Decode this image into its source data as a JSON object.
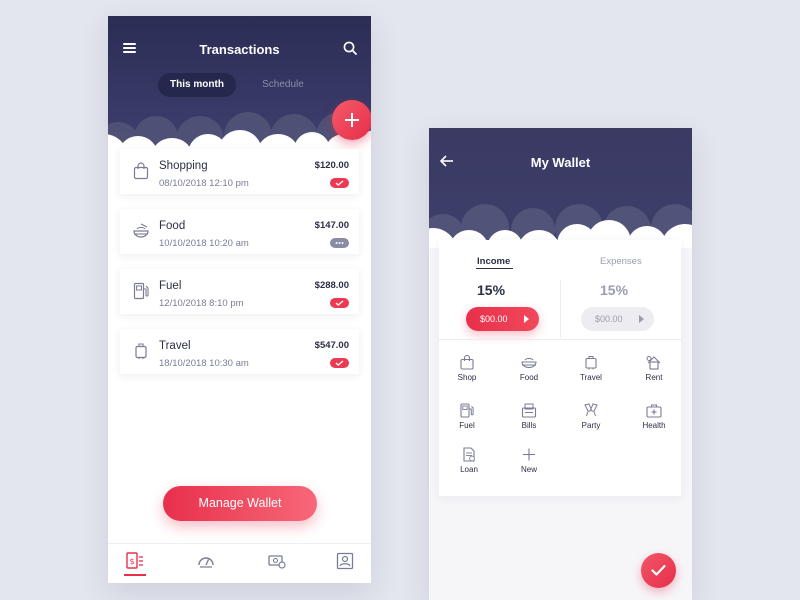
{
  "transactions_screen": {
    "title": "Transactions",
    "tabs": [
      {
        "label": "This month",
        "active": true
      },
      {
        "label": "Schedule",
        "active": false
      }
    ],
    "items": [
      {
        "name": "Shopping",
        "date": "08/10/2018  12:10 pm",
        "amount": "$120.00",
        "status": "done",
        "icon": "shopping-bag-icon"
      },
      {
        "name": "Food",
        "date": "10/10/2018  10:20 am",
        "amount": "$147.00",
        "status": "pending",
        "icon": "food-bowl-icon"
      },
      {
        "name": "Fuel",
        "date": "12/10/2018  8:10 pm",
        "amount": "$288.00",
        "status": "done",
        "icon": "fuel-pump-icon"
      },
      {
        "name": "Travel",
        "date": "18/10/2018  10:30 am",
        "amount": "$547.00",
        "status": "done",
        "icon": "luggage-icon"
      }
    ],
    "manage_button": "Manage Wallet",
    "nav": [
      {
        "icon": "wallet-list-icon",
        "active": true
      },
      {
        "icon": "speedometer-icon",
        "active": false
      },
      {
        "icon": "money-icon",
        "active": false
      },
      {
        "icon": "profile-card-icon",
        "active": false
      }
    ]
  },
  "wallet_screen": {
    "title": "My Wallet",
    "tabs": {
      "income": "Income",
      "expenses": "Expenses"
    },
    "income": {
      "percent": "15%",
      "amount": "$00.00"
    },
    "expenses": {
      "percent": "15%",
      "amount": "$00.00"
    },
    "categories": [
      {
        "label": "Shop",
        "icon": "shopping-bag-icon"
      },
      {
        "label": "Food",
        "icon": "food-bowl-icon"
      },
      {
        "label": "Travel",
        "icon": "luggage-icon"
      },
      {
        "label": "Rent",
        "icon": "rent-house-icon"
      },
      {
        "label": "Fuel",
        "icon": "fuel-pump-icon"
      },
      {
        "label": "Bills",
        "icon": "bills-icon"
      },
      {
        "label": "Party",
        "icon": "party-glasses-icon"
      },
      {
        "label": "Health",
        "icon": "medical-kit-icon"
      },
      {
        "label": "Loan",
        "icon": "loan-document-icon"
      },
      {
        "label": "New",
        "icon": "plus-icon"
      }
    ]
  },
  "colors": {
    "header_dark": "#2b2d55",
    "accent_red": "#e8304b",
    "background": "#e3e6ee"
  }
}
